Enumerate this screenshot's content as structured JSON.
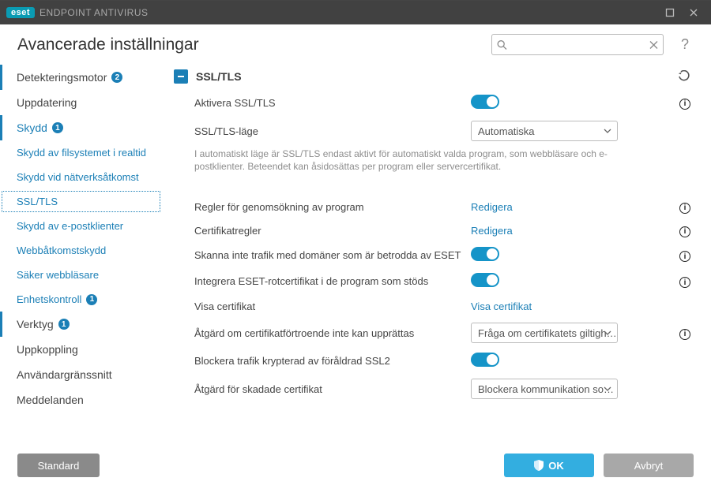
{
  "brand": {
    "badge": "eset",
    "product": "ENDPOINT ANTIVIRUS"
  },
  "header": {
    "title": "Avancerade inställningar",
    "search_placeholder": ""
  },
  "sidebar": {
    "items": [
      {
        "label": "Detekteringsmotor",
        "badge": "2"
      },
      {
        "label": "Uppdatering"
      },
      {
        "label": "Skydd",
        "badge": "1"
      },
      {
        "label": "Skydd av filsystemet i realtid"
      },
      {
        "label": "Skydd vid nätverksåtkomst"
      },
      {
        "label": "SSL/TLS"
      },
      {
        "label": "Skydd av e-postklienter"
      },
      {
        "label": "Webbåtkomstskydd"
      },
      {
        "label": "Säker webbläsare"
      },
      {
        "label": "Enhetskontroll",
        "badge": "1"
      },
      {
        "label": "Verktyg",
        "badge": "1"
      },
      {
        "label": "Uppkoppling"
      },
      {
        "label": "Användargränssnitt"
      },
      {
        "label": "Meddelanden"
      }
    ]
  },
  "section": {
    "title": "SSL/TLS",
    "rows": {
      "enable": "Aktivera SSL/TLS",
      "mode": "SSL/TLS-läge",
      "mode_value": "Automatiska",
      "mode_desc": "I automatiskt läge är SSL/TLS endast aktivt för automatiskt valda program, som webbläsare och e-postklienter. Beteendet kan åsidosättas per program eller servercertifikat.",
      "app_rules": "Regler för genomsökning av program",
      "cert_rules": "Certifikatregler",
      "edit": "Redigera",
      "trusted_scan": "Skanna inte trafik med domäner som är betrodda av ESET",
      "integrate": "Integrera ESET-rotcertifikat i de program som stöds",
      "view_cert_label": "Visa certifikat",
      "view_cert_link": "Visa certifikat",
      "trust_action": "Åtgärd om certifikatförtroende inte kan upprättas",
      "trust_action_value": "Fråga om certifikatets giltigh…",
      "block_ssl2": "Blockera trafik krypterad av föråldrad SSL2",
      "damaged_action": "Åtgärd för skadade certifikat",
      "damaged_action_value": "Blockera kommunikation so…"
    }
  },
  "footer": {
    "standard": "Standard",
    "ok": "OK",
    "cancel": "Avbryt"
  }
}
